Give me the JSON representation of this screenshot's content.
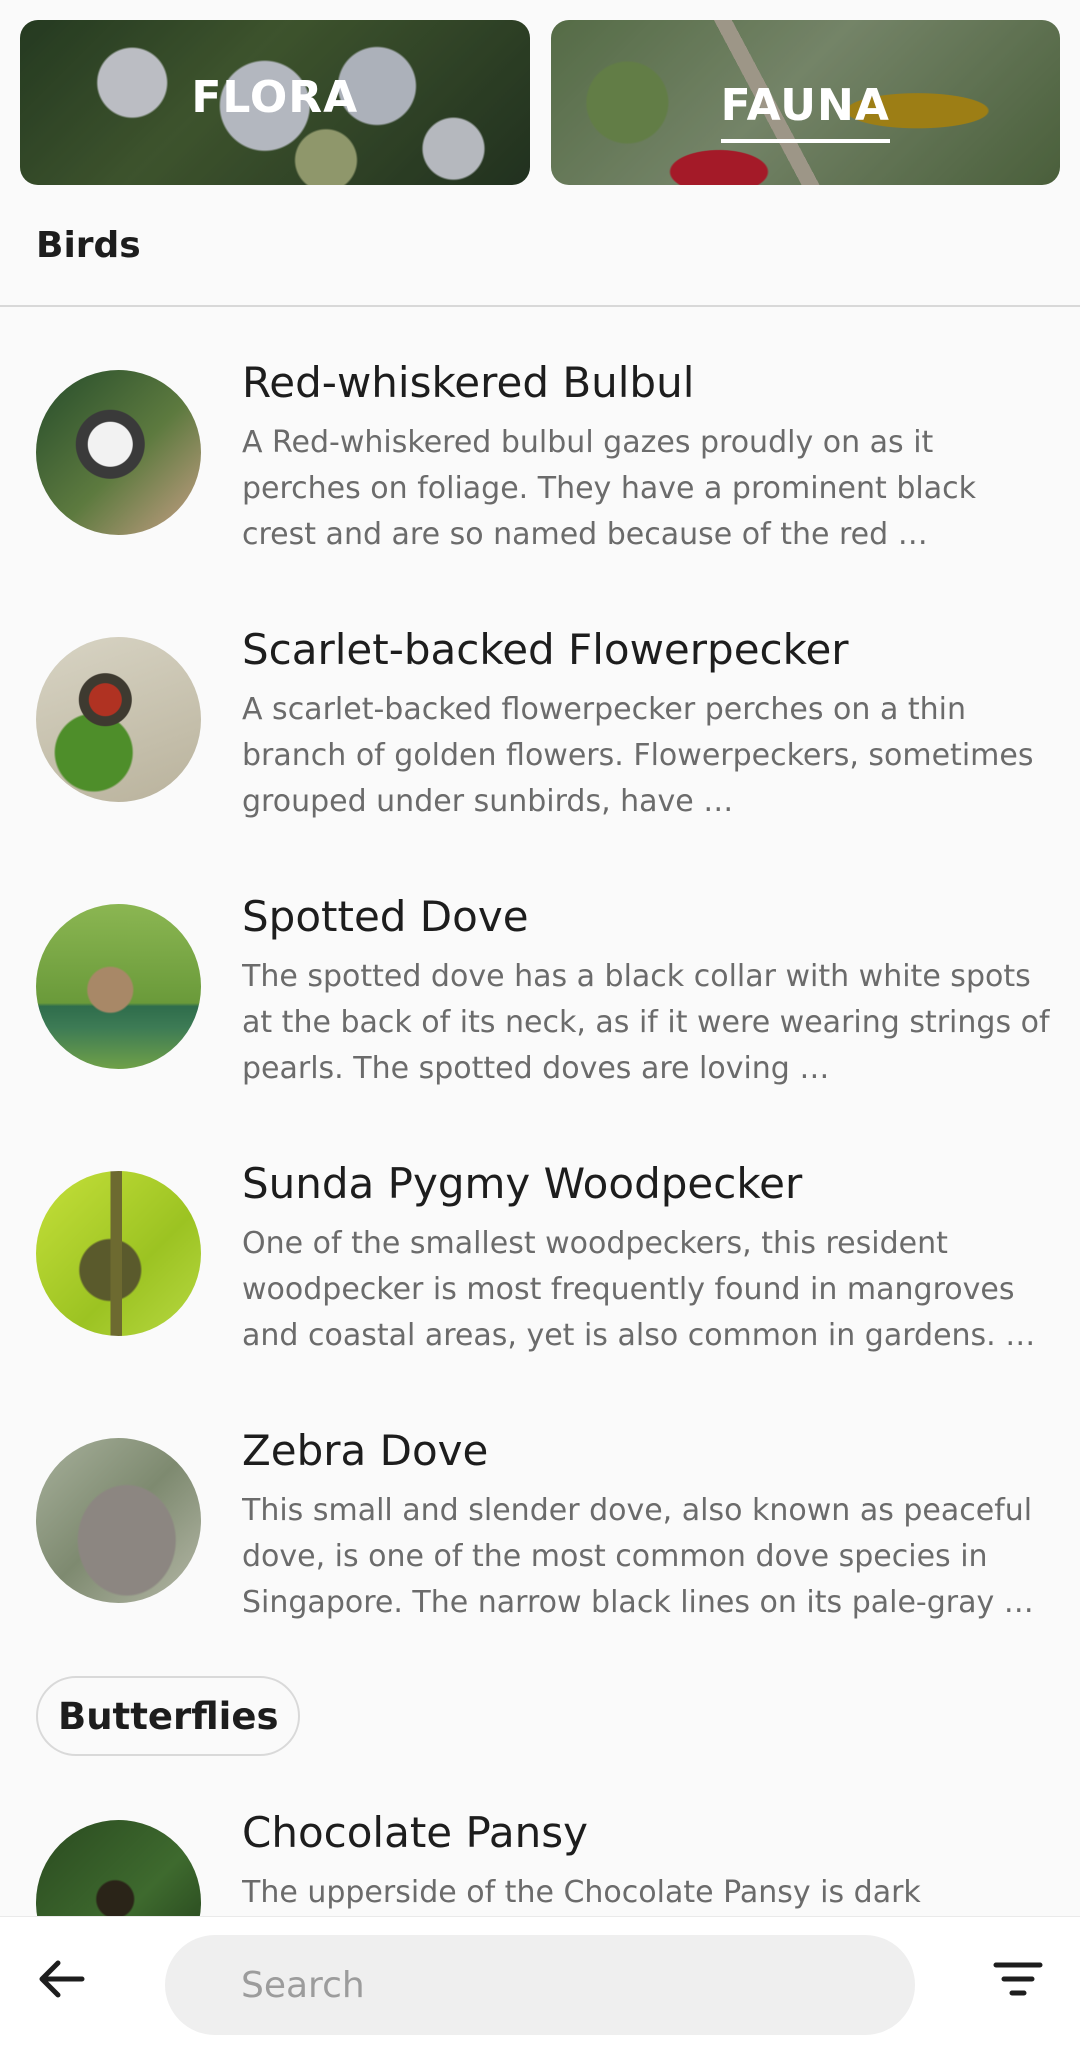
{
  "tabs": [
    {
      "label": "FLORA",
      "active": false
    },
    {
      "label": "FAUNA",
      "active": true
    }
  ],
  "section": {
    "title": "Birds"
  },
  "birds": [
    {
      "title": "Red-whiskered Bulbul",
      "description": "A Red-whiskered bulbul gazes proudly on as it perches on foliage. They have a prominent black crest and are so named because of the red …"
    },
    {
      "title": "Scarlet-backed Flowerpecker",
      "description": "A scarlet-backed flowerpecker perches on a thin branch of golden flowers. Flowerpeckers, sometimes grouped under sunbirds, have …"
    },
    {
      "title": "Spotted Dove",
      "description": "The spotted dove has a black collar with white spots at the back of its neck, as if it were wearing strings of pearls. The spotted doves are loving …"
    },
    {
      "title": "Sunda Pygmy Woodpecker",
      "description": "One of the smallest woodpeckers, this resident woodpecker is most frequently found in mangroves and coastal areas, yet is also common in gardens. …"
    },
    {
      "title": "Zebra Dove",
      "description": "This small and slender dove, also known as peaceful dove, is one of the most common dove species in Singapore. The narrow black lines on its pale-gray …"
    }
  ],
  "chip": {
    "label": "Butterflies"
  },
  "butterflies": [
    {
      "title": "Chocolate Pansy",
      "description": "The upperside of the Chocolate Pansy is dark"
    }
  ],
  "bottom_bar": {
    "back_icon": "arrow-left-icon",
    "search_placeholder": "Search",
    "filter_icon": "filter-icon"
  }
}
